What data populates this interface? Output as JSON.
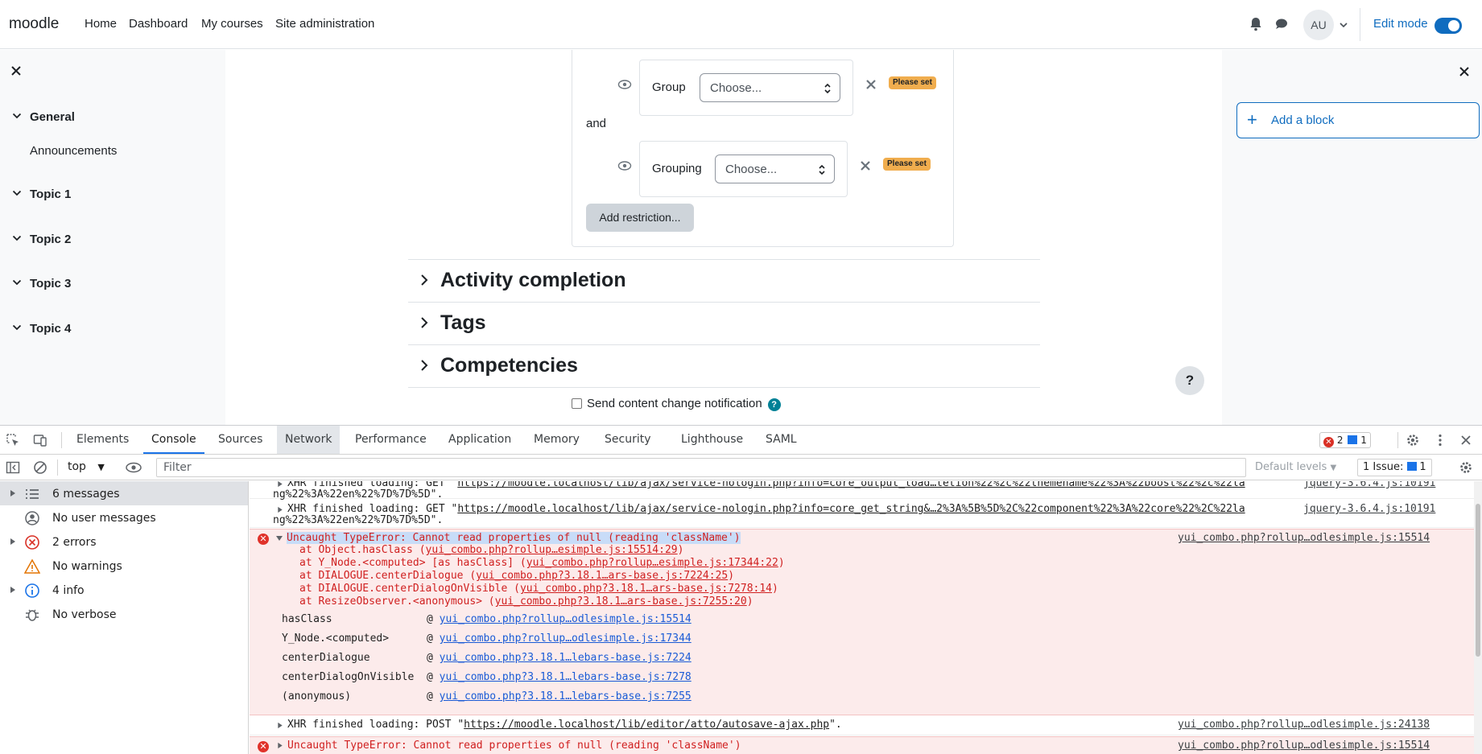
{
  "navbar": {
    "brand": "moodle",
    "links": [
      "Home",
      "Dashboard",
      "My courses",
      "Site administration"
    ],
    "avatar_initials": "AU",
    "edit_mode_label": "Edit mode",
    "edit_mode_on": true
  },
  "course_index": {
    "sections": [
      {
        "label": "General",
        "items": [
          "Announcements"
        ]
      },
      {
        "label": "Topic 1"
      },
      {
        "label": "Topic 2"
      },
      {
        "label": "Topic 3"
      },
      {
        "label": "Topic 4"
      }
    ]
  },
  "restrictions": {
    "conditions": [
      {
        "label": "Group",
        "select_value": "Choose...",
        "badge": "Please set"
      },
      {
        "label": "Grouping",
        "select_value": "Choose...",
        "badge": "Please set"
      }
    ],
    "joiner": "and",
    "add_button": "Add restriction..."
  },
  "form_sections": [
    "Activity completion",
    "Tags",
    "Competencies"
  ],
  "notify_label": "Send content change notification",
  "help_glyph": "?",
  "right_drawer": {
    "add_block": "Add a block"
  },
  "devtools": {
    "tabs": [
      "Elements",
      "Console",
      "Sources",
      "Network",
      "Performance",
      "Application",
      "Memory",
      "Security",
      "Lighthouse",
      "SAML"
    ],
    "active_tab": "Console",
    "error_count": "2",
    "message_count": "1",
    "context": "top",
    "filter_placeholder": "Filter",
    "levels": "Default levels",
    "issues_label": "1 Issue:",
    "issues_count": "1",
    "sidebar": [
      {
        "label": "6 messages",
        "icon": "list-icon"
      },
      {
        "label": "No user messages",
        "icon": "user-icon"
      },
      {
        "label": "2 errors",
        "icon": "error-icon"
      },
      {
        "label": "No warnings",
        "icon": "warning-icon"
      },
      {
        "label": "4 info",
        "icon": "info-icon"
      },
      {
        "label": "No verbose",
        "icon": "bug-icon"
      }
    ],
    "console": {
      "xhr1_prefix": "XHR finished loading: GET \"",
      "xhr1_url": "https://moodle.localhost/lib/ajax/service-nologin.php?info=core_output_load…tetion%22%2c%22themename%22%3A%22boost%22%2c%22la",
      "xhr1_cont": "ng%22%3A%22en%22%7D%7D%5D\".",
      "xhr1_src": "jquery-3.6.4.js:10191",
      "xhr2_prefix": "XHR finished loading: GET \"",
      "xhr2_url": "https://moodle.localhost/lib/ajax/service-nologin.php?info=core_get_string&…2%3A%5B%5D%2C%22component%22%3A%22core%22%2C%22la",
      "xhr2_cont": "ng%22%3A%22en%22%7D%7D%5D\".",
      "xhr2_src": "jquery-3.6.4.js:10191",
      "error_message": "Uncaught TypeError: Cannot read properties of null (reading 'className')",
      "error_src": "yui_combo.php?rollup…odlesimple.js:15514",
      "stack": [
        {
          "pre": "at Object.hasClass (",
          "loc": "yui_combo.php?rollup…esimple.js:15514:29",
          "post": ")"
        },
        {
          "pre": "at Y_Node.<computed> [as hasClass] (",
          "loc": "yui_combo.php?rollup…esimple.js:17344:22",
          "post": ")"
        },
        {
          "pre": "at DIALOGUE.centerDialogue (",
          "loc": "yui_combo.php?3.18.1…ars-base.js:7224:25",
          "post": ")"
        },
        {
          "pre": "at DIALOGUE.centerDialogOnVisible (",
          "loc": "yui_combo.php?3.18.1…ars-base.js:7278:14",
          "post": ")"
        },
        {
          "pre": "at ResizeObserver.<anonymous> (",
          "loc": "yui_combo.php?3.18.1…ars-base.js:7255:20",
          "post": ")"
        }
      ],
      "frames": [
        {
          "fn": "hasClass",
          "loc": "yui_combo.php?rollup…odlesimple.js:15514"
        },
        {
          "fn": "Y_Node.<computed>",
          "loc": "yui_combo.php?rollup…odlesimple.js:17344"
        },
        {
          "fn": "centerDialogue",
          "loc": "yui_combo.php?3.18.1…lebars-base.js:7224"
        },
        {
          "fn": "centerDialogOnVisible",
          "loc": "yui_combo.php?3.18.1…lebars-base.js:7278"
        },
        {
          "fn": "(anonymous)",
          "loc": "yui_combo.php?3.18.1…lebars-base.js:7255"
        }
      ],
      "frame_at": "@",
      "xhr3_prefix": "XHR finished loading: POST \"",
      "xhr3_url": "https://moodle.localhost/lib/editor/atto/autosave-ajax.php",
      "xhr3_suffix": "\".",
      "xhr3_src": "yui_combo.php?rollup…odlesimple.js:24138",
      "error2_message": "Uncaught TypeError: Cannot read properties of null (reading 'className')",
      "error2_src": "yui_combo.php?rollup…odlesimple.js:15514"
    }
  }
}
